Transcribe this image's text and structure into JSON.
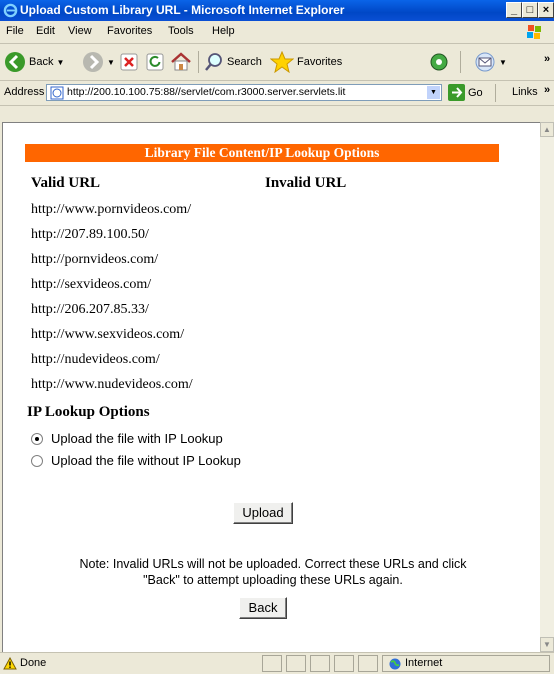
{
  "window": {
    "title": "Upload Custom Library URL - Microsoft Internet Explorer",
    "controls": [
      "_",
      "□",
      "×"
    ]
  },
  "menu": [
    "File",
    "Edit",
    "View",
    "Favorites",
    "Tools",
    "Help"
  ],
  "toolbar": {
    "back_label": "Back",
    "search_label": "Search",
    "favorites_label": "Favorites",
    "overflow": "»"
  },
  "address": {
    "label": "Address",
    "url": "http://200.10.100.75:88//servlet/com.r3000.server.servlets.lit",
    "go_label": "Go",
    "links_label": "Links"
  },
  "page": {
    "banner": "Library File Content/IP Lookup Options",
    "valid_header": "Valid URL",
    "invalid_header": "Invalid URL",
    "valid_urls": [
      "http://www.pornvideos.com/",
      "http://207.89.100.50/",
      "http://pornvideos.com/",
      "http://sexvideos.com/",
      "http://206.207.85.33/",
      "http://www.sexvideos.com/",
      "http://nudevideos.com/",
      "http://www.nudevideos.com/"
    ],
    "invalid_urls": [],
    "ip_options_header": "IP Lookup Options",
    "options": [
      {
        "label": "Upload the file with IP Lookup",
        "checked": true
      },
      {
        "label": "Upload the file without IP Lookup",
        "checked": false
      }
    ],
    "upload_label": "Upload",
    "note_line1": "Note: Invalid URLs will not be uploaded. Correct these URLs and click",
    "note_line2": "\"Back\" to attempt uploading these URLs again.",
    "back_label": "Back"
  },
  "status": {
    "text": "Done",
    "zone": "Internet"
  }
}
